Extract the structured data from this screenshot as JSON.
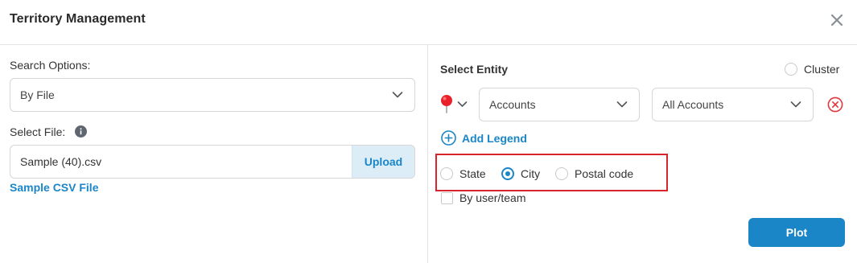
{
  "dialog": {
    "title": "Territory Management"
  },
  "left": {
    "search_options_label": "Search Options:",
    "search_options_value": "By File",
    "select_file_label": "Select File:",
    "file_name": "Sample (40).csv",
    "upload_label": "Upload",
    "sample_link": "Sample CSV File"
  },
  "right": {
    "select_entity_label": "Select Entity",
    "cluster_label": "Cluster",
    "entity_value": "Accounts",
    "scope_value": "All Accounts",
    "add_legend_label": "Add Legend",
    "level_options": [
      {
        "label": "State",
        "checked": false
      },
      {
        "label": "City",
        "checked": true
      },
      {
        "label": "Postal code",
        "checked": false
      }
    ],
    "by_user_team_label": "By user/team",
    "plot_label": "Plot"
  },
  "colors": {
    "accent": "#1a86c8",
    "highlight": "#d9232d",
    "pin": "#e8202a"
  }
}
